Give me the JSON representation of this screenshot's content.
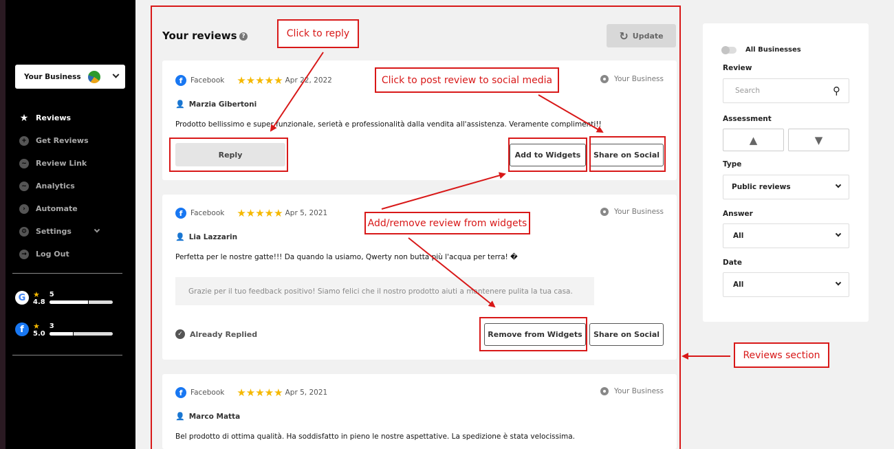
{
  "sidebar": {
    "business_selector": "Your Business",
    "nav": [
      {
        "label": "Reviews",
        "icon": "star-icon",
        "active": true
      },
      {
        "label": "Get Reviews",
        "icon": "plus-icon"
      },
      {
        "label": "Review Link",
        "icon": "chat-icon"
      },
      {
        "label": "Analytics",
        "icon": "chart-icon"
      },
      {
        "label": "Automate",
        "icon": "automate-icon"
      },
      {
        "label": "Settings",
        "icon": "gear-icon"
      },
      {
        "label": "Log Out",
        "icon": "logout-icon"
      }
    ],
    "ratings": [
      {
        "platform": "google",
        "score": "4.8",
        "count": "5",
        "fill": 0.62
      },
      {
        "platform": "facebook",
        "score": "5.0",
        "count": "3",
        "fill": 0.38
      }
    ]
  },
  "main": {
    "title": "Your reviews",
    "help": "?",
    "update_label": "Update",
    "reviews": [
      {
        "source": "Facebook",
        "stars": "★★★★★",
        "date": "Apr 22, 2022",
        "business": "Your Business",
        "author": "Marzia Gibertoni",
        "text": "Prodotto bellissimo e super funzionale, serietà e professionalità dalla vendita all'assistenza. Veramente complimenti!!",
        "reply_label": "Reply",
        "widget_label": "Add to Widgets",
        "share_label": "Share on Social"
      },
      {
        "source": "Facebook",
        "stars": "★★★★★",
        "date": "Apr 5, 2021",
        "business": "Your Business",
        "author": "Lia Lazzarin",
        "text": "Perfetta per le nostre gatte!!! Da quando la usiamo, Qwerty non butta più l'acqua per terra! �",
        "reply_text": "Grazie per il tuo feedback positivo! Siamo felici che il nostro prodotto aiuti a mantenere pulita la tua casa.",
        "replied_label": "Already Replied",
        "widget_label": "Remove from Widgets",
        "share_label": "Share on Social"
      },
      {
        "source": "Facebook",
        "stars": "★★★★★",
        "date": "Apr 5, 2021",
        "business": "Your Business",
        "author": "Marco Matta",
        "text": "Bel prodotto di ottima qualità. Ha soddisfatto in pieno le nostre aspettative. La spedizione è stata velocissima."
      }
    ]
  },
  "filters": {
    "all_businesses": "All Businesses",
    "review_label": "Review",
    "search_placeholder": "Search",
    "assessment_label": "Assessment",
    "type_label": "Type",
    "type_value": "Public reviews",
    "answer_label": "Answer",
    "answer_value": "All",
    "date_label": "Date",
    "date_value": "All"
  },
  "annotations": {
    "click_to_reply": "Click to reply",
    "post_to_social": "Click to post review to social media",
    "add_remove_widgets": "Add/remove review from widgets",
    "reviews_section": "Reviews section"
  },
  "colors": {
    "annotation": "#d81818",
    "star": "#f5b800",
    "facebook": "#1877f2"
  }
}
